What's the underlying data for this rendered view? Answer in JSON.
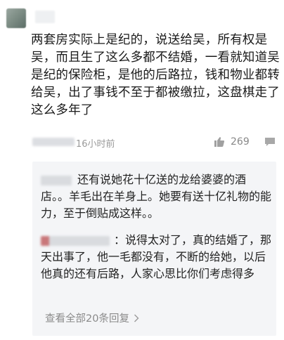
{
  "post": {
    "text": "两套房实际上是纪的，说送给吴，所有权是吴，而且生了这么多都不结婚，一看就知道吴是纪的保险柜，是他的后路拉，钱和物业都转给吴，出了事钱不至于都被缴拉，这盘棋走了这么多年了",
    "timestamp": "16小时前",
    "likes": "269"
  },
  "replies": [
    {
      "text": "还有说她花十亿送的龙给婆婆的酒店。。羊毛出在羊身上。她要有送十亿礼物的能力，至于倒贴成这样。。"
    },
    {
      "text": "：说得太对了，真的结婚了，那天出事了，他一毛都没有，不断的给她，以后他真的还有后路，人家心思比你们考虑得多"
    }
  ],
  "view_all_label": "查看全部20条回复",
  "icons": {
    "like": "thumbs-up-icon",
    "comment": "comment-icon",
    "chevron": "chevron-right-icon"
  }
}
